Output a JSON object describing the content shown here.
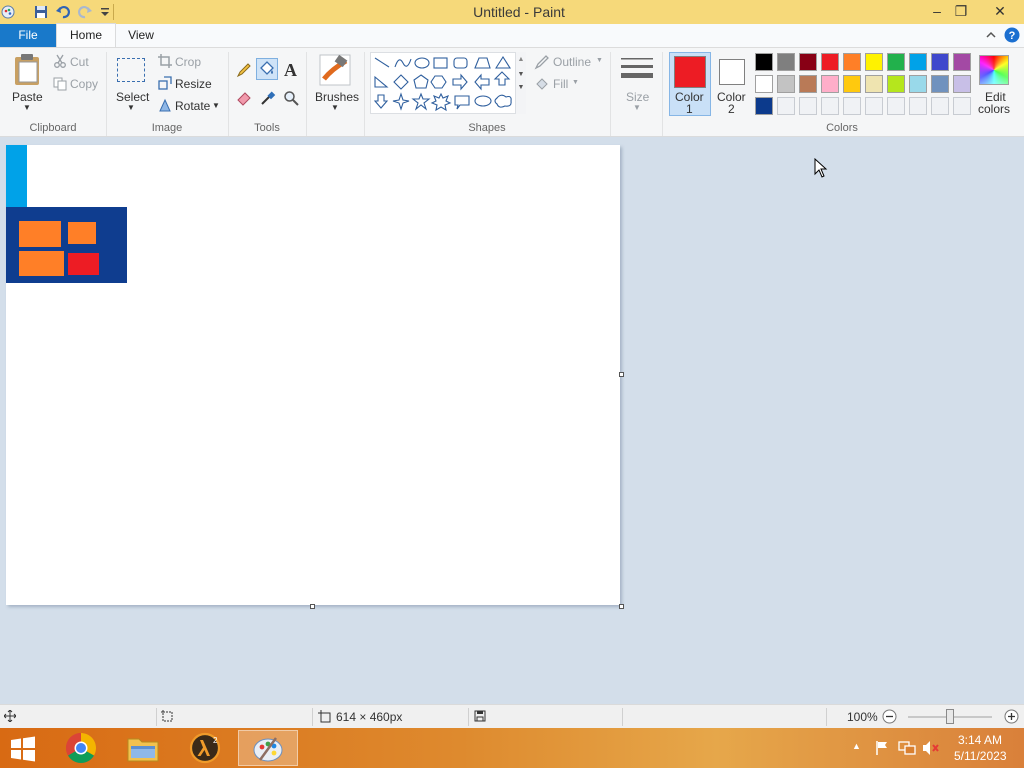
{
  "window": {
    "title": "Untitled - Paint",
    "minimize": "–",
    "restore": "❐",
    "close": "✕"
  },
  "tabs": {
    "file": "File",
    "home": "Home",
    "view": "View"
  },
  "clipboard": {
    "paste": "Paste",
    "cut": "Cut",
    "copy": "Copy",
    "group": "Clipboard"
  },
  "image": {
    "select": "Select",
    "crop": "Crop",
    "resize": "Resize",
    "rotate": "Rotate",
    "group": "Image"
  },
  "tools": {
    "group": "Tools",
    "text_glyph": "A"
  },
  "brushes": {
    "label": "Brushes"
  },
  "shapes": {
    "outline": "Outline",
    "fill": "Fill",
    "group": "Shapes"
  },
  "size": {
    "label": "Size"
  },
  "colors": {
    "color1_line1": "Color",
    "color1_line2": "1",
    "color2_line1": "Color",
    "color2_line2": "2",
    "edit_line1": "Edit",
    "edit_line2": "colors",
    "group": "Colors",
    "color1_value": "#ed1c24",
    "color2_value": "#ffffff",
    "palette": [
      [
        "#000000",
        "#7f7f7f",
        "#880015",
        "#ed1c24",
        "#ff7f27",
        "#fff200",
        "#22b14c",
        "#00a2e8",
        "#3f48cc",
        "#a349a4"
      ],
      [
        "#ffffff",
        "#c3c3c3",
        "#b97a57",
        "#ffaec9",
        "#ffc90e",
        "#efe4b0",
        "#b5e61d",
        "#99d9ea",
        "#7092be",
        "#c8bfe7"
      ],
      [
        "#0c3a8c",
        "#f0f2f5",
        "#f0f2f5",
        "#f0f2f5",
        "#f0f2f5",
        "#f0f2f5",
        "#f0f2f5",
        "#f0f2f5",
        "#f0f2f5",
        "#f0f2f5"
      ]
    ]
  },
  "status": {
    "dimensions": "614 × 460px",
    "zoom": "100%"
  },
  "clock": {
    "time": "3:14 AM",
    "date": "5/11/2023"
  }
}
